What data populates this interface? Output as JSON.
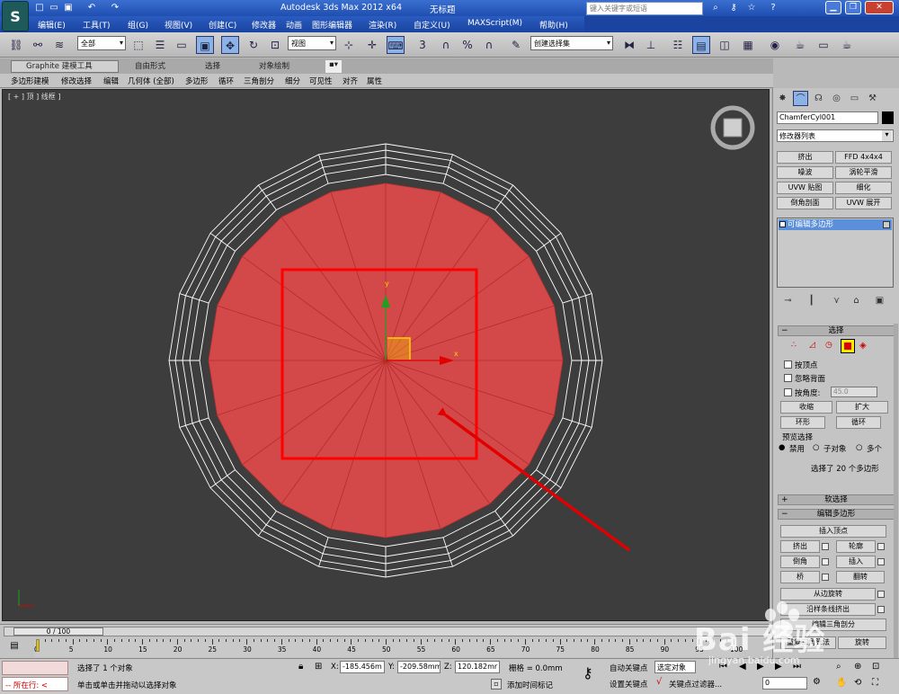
{
  "titlebar": {
    "app_title": "Autodesk 3ds Max  2012 x64",
    "doc_title": "无标题",
    "search_placeholder": "键入关键字或短语",
    "window_buttons": [
      "minimize",
      "restore",
      "close"
    ]
  },
  "menus": [
    "编辑(E)",
    "工具(T)",
    "组(G)",
    "视图(V)",
    "创建(C)",
    "修改器",
    "动画",
    "图形编辑器",
    "渲染(R)",
    "自定义(U)",
    "MAXScript(M)",
    "帮助(H)"
  ],
  "toolbar": {
    "selection_filter": "全部",
    "ref_coord": "视图",
    "named_selection": "创建选择集"
  },
  "ribbon": {
    "tabs": [
      "Graphite 建模工具",
      "自由形式",
      "选择",
      "对象绘制"
    ],
    "items": [
      "多边形建模",
      "修改选择",
      "编辑",
      "几何体 (全部)",
      "多边形",
      "循环",
      "三角剖分",
      "细分",
      "可见性",
      "对齐",
      "属性"
    ]
  },
  "viewport": {
    "label": "[ + ] 顶 ] 线框 ]",
    "axis_x": "x",
    "axis_y": "y"
  },
  "cmdpanel": {
    "object_name": "ChamferCyl001",
    "modifier_list": "修改器列表",
    "modifier_buttons": [
      "挤出",
      "FFD 4x4x4",
      "噪波",
      "涡轮平滑",
      "UVW 贴图",
      "细化",
      "倒角剖面",
      "UVW 展开"
    ],
    "stack_item": "可编辑多边形",
    "selection": {
      "header": "选择",
      "by_vertex": "按顶点",
      "ignore_backfacing": "忽略背面",
      "by_angle": "按角度:",
      "angle_value": "45.0",
      "shrink": "收缩",
      "grow": "扩大",
      "ring": "环形",
      "loop": "循环",
      "preview_label": "预览选择",
      "preview_off": "禁用",
      "preview_subobj": "子对象",
      "preview_multi": "多个",
      "selected_info": "选择了 20 个多边形"
    },
    "soft_selection": "软选择",
    "edit_polygons": {
      "header": "编辑多边形",
      "insert_vertex": "插入顶点",
      "extrude": "挤出",
      "outline": "轮廓",
      "bevel": "倒角",
      "inset": "插入",
      "bridge": "桥",
      "flip": "翻转",
      "hinge": "从边旋转",
      "extrude_spline": "沿样条线挤出",
      "edit_tri": "编辑三角剖分",
      "retriangulate": "重复三角算法",
      "turn": "旋转"
    }
  },
  "timeline": {
    "frame_counter": "0 / 100",
    "ticks": [
      "0",
      "5",
      "10",
      "15",
      "20",
      "25",
      "30",
      "35",
      "40",
      "45",
      "50",
      "55",
      "60",
      "65",
      "70",
      "75",
      "80",
      "85",
      "90",
      "95",
      "100"
    ]
  },
  "status": {
    "running": "所在行:",
    "selected": "选择了 1 个对象",
    "prompt": "单击或单击并拖动以选择对象",
    "x_label": "X:",
    "x_value": "-185.456m",
    "y_label": "Y:",
    "y_value": "-209.58mm",
    "z_label": "Z:",
    "z_value": "120.182mr",
    "grid": "栅格 = 0.0mm",
    "add_time_tag": "添加时间标记",
    "auto_key": "自动关键点",
    "selected_obj": "选定对象",
    "set_key": "设置关键点",
    "key_filters": "关键点过滤器...",
    "frame_value": "0"
  },
  "watermark": {
    "brand": "Bai 经验",
    "url": "jingyan.baidu.com"
  }
}
